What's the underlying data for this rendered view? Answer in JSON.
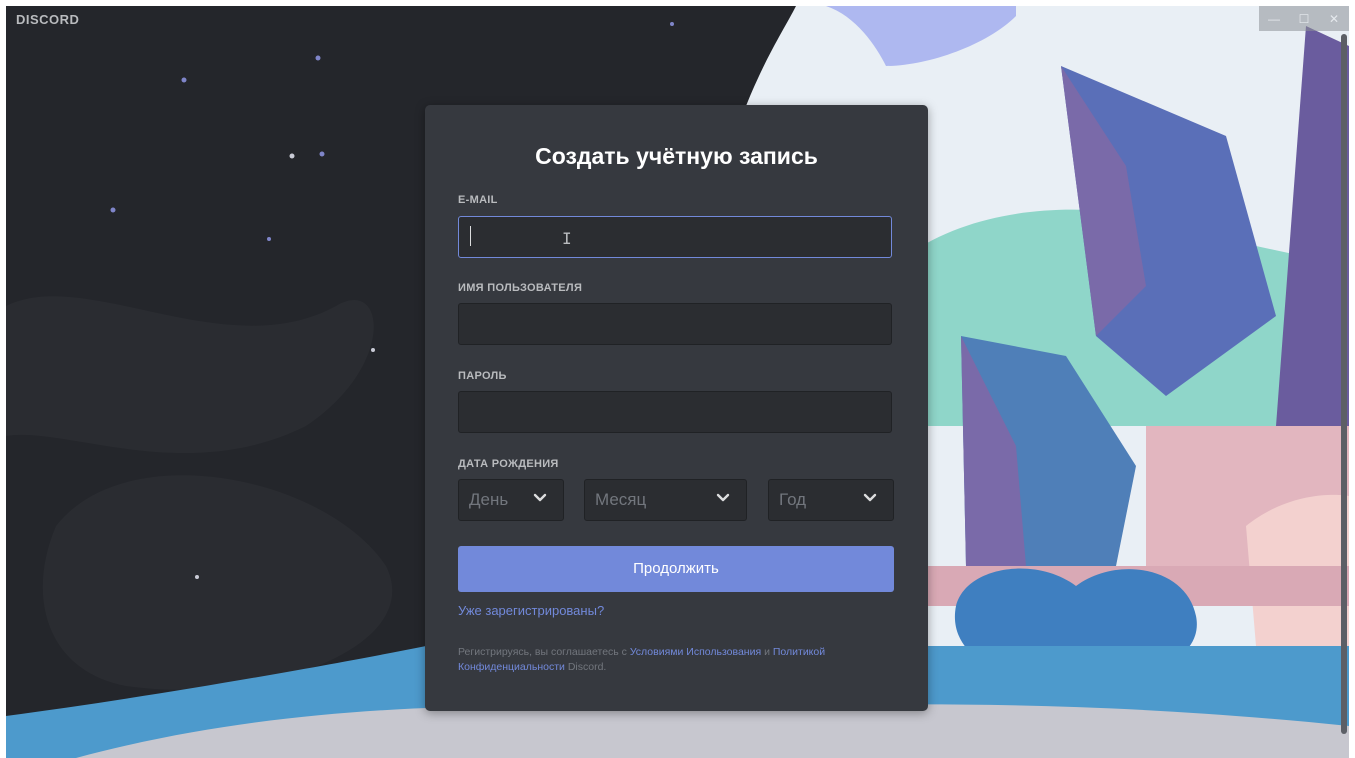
{
  "app": {
    "brand": "DISCORD"
  },
  "window_controls": {
    "minimize": "—",
    "maximize": "☐",
    "close": "✕"
  },
  "form": {
    "title": "Создать учётную запись",
    "email": {
      "label": "E-MAIL",
      "value": "",
      "placeholder": ""
    },
    "username": {
      "label": "ИМЯ ПОЛЬЗОВАТЕЛЯ",
      "value": "",
      "placeholder": ""
    },
    "password": {
      "label": "ПАРОЛЬ",
      "value": "",
      "placeholder": ""
    },
    "birthdate": {
      "label": "ДАТА РОЖДЕНИЯ",
      "day_placeholder": "День",
      "month_placeholder": "Месяц",
      "year_placeholder": "Год"
    },
    "continue_label": "Продолжить",
    "login_link": "Уже зарегистрированы?",
    "terms": {
      "prefix": "Регистрируясь, вы соглашаетесь с ",
      "tos_link": "Условиями Использования",
      "and": " и ",
      "privacy_link_1": "Политикой",
      "privacy_link_2": "Конфиденциальности",
      "suffix": " Discord."
    }
  },
  "colors": {
    "accent": "#7289da",
    "card_bg": "#36393f",
    "input_bg": "#2b2d31",
    "app_bg": "#24262b"
  }
}
